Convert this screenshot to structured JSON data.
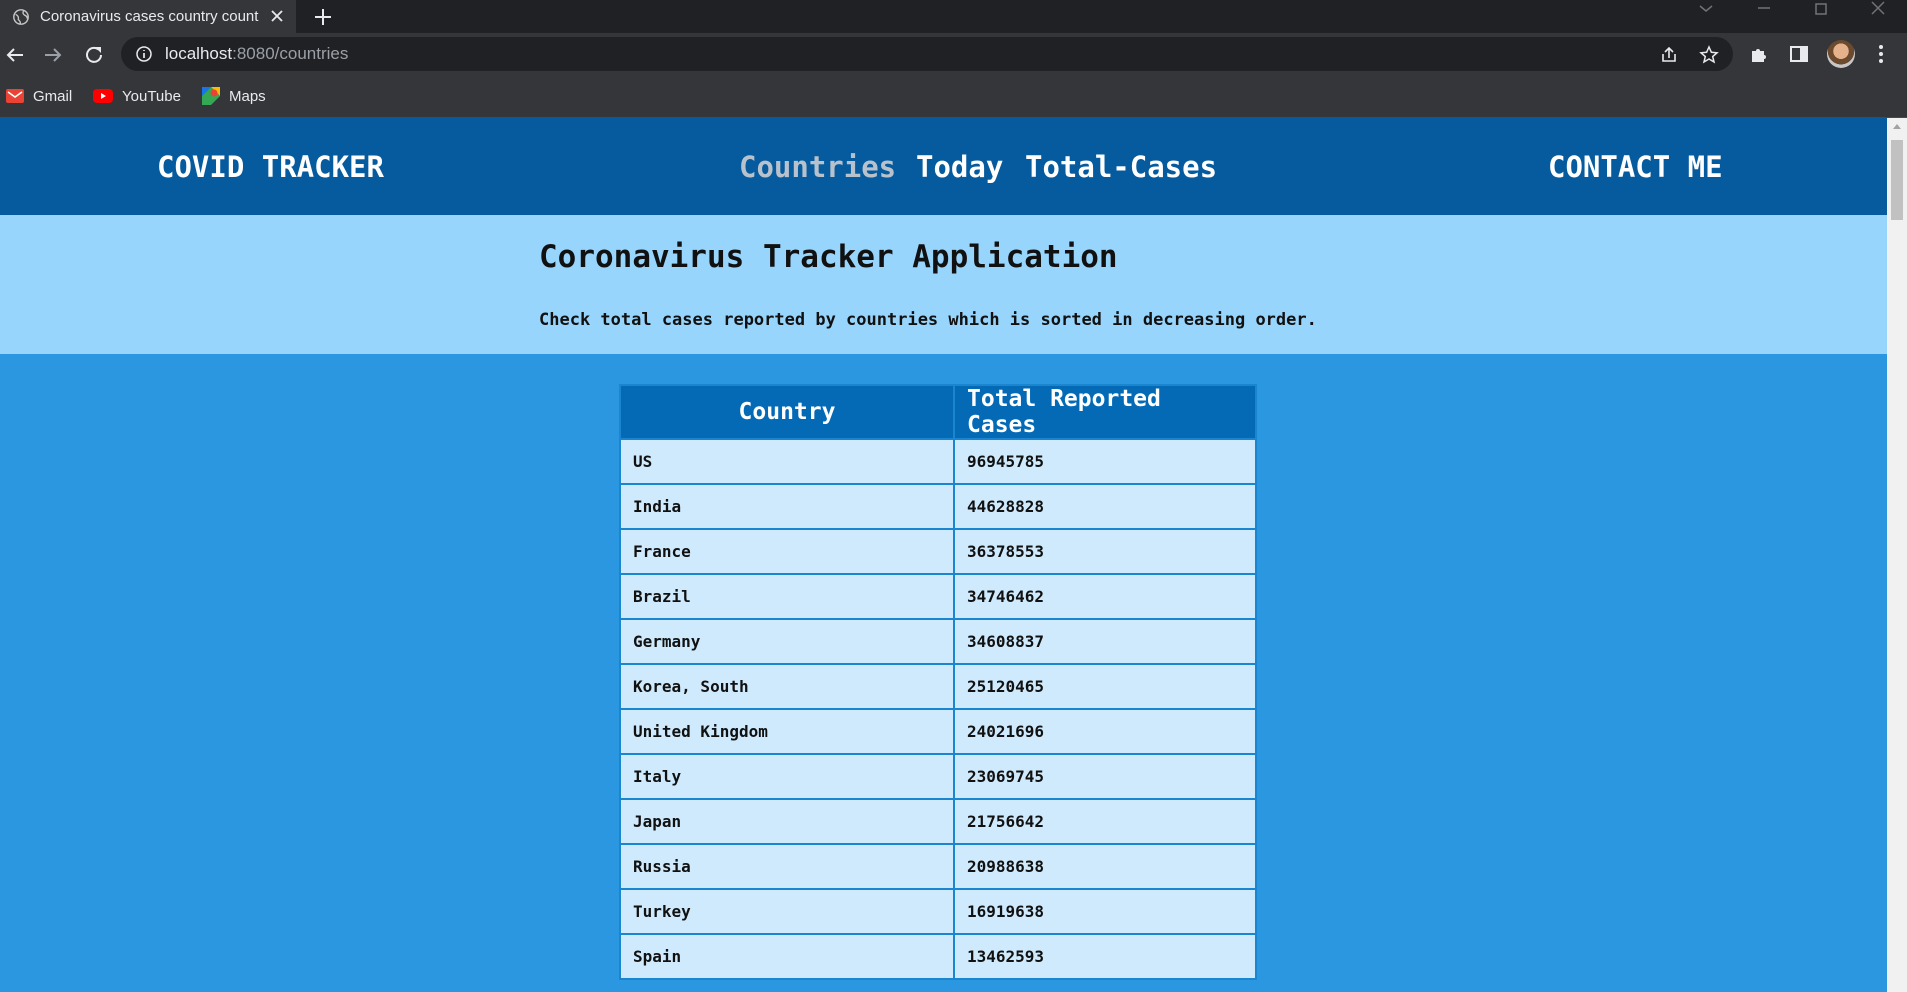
{
  "browser": {
    "tab_title": "Coronavirus cases country count",
    "url_host": "localhost",
    "url_path": ":8080/countries",
    "bookmarks": [
      "Gmail",
      "YouTube",
      "Maps"
    ]
  },
  "site": {
    "brand": "COVID TRACKER",
    "nav": [
      "Countries",
      "Today",
      "Total-Cases"
    ],
    "active_nav": "Countries",
    "contact": "CONTACT ME"
  },
  "hero": {
    "title": "Coronavirus Tracker Application",
    "subtitle": "Check total cases reported by countries which is sorted in decreasing order."
  },
  "table": {
    "headers": [
      "Country",
      "Total Reported Cases"
    ],
    "rows": [
      [
        "US",
        "96945785"
      ],
      [
        "India",
        "44628828"
      ],
      [
        "France",
        "36378553"
      ],
      [
        "Brazil",
        "34746462"
      ],
      [
        "Germany",
        "34608837"
      ],
      [
        "Korea, South",
        "25120465"
      ],
      [
        "United Kingdom",
        "24021696"
      ],
      [
        "Italy",
        "23069745"
      ],
      [
        "Japan",
        "21756642"
      ],
      [
        "Russia",
        "20988638"
      ],
      [
        "Turkey",
        "16919638"
      ],
      [
        "Spain",
        "13462593"
      ]
    ]
  },
  "colors": {
    "nav_bg": "#055b9d",
    "hero_bg": "#97d5fd",
    "page_bg": "#2a97e0",
    "table_header_bg": "#046ab6",
    "table_cell_bg": "#cfeafd"
  }
}
